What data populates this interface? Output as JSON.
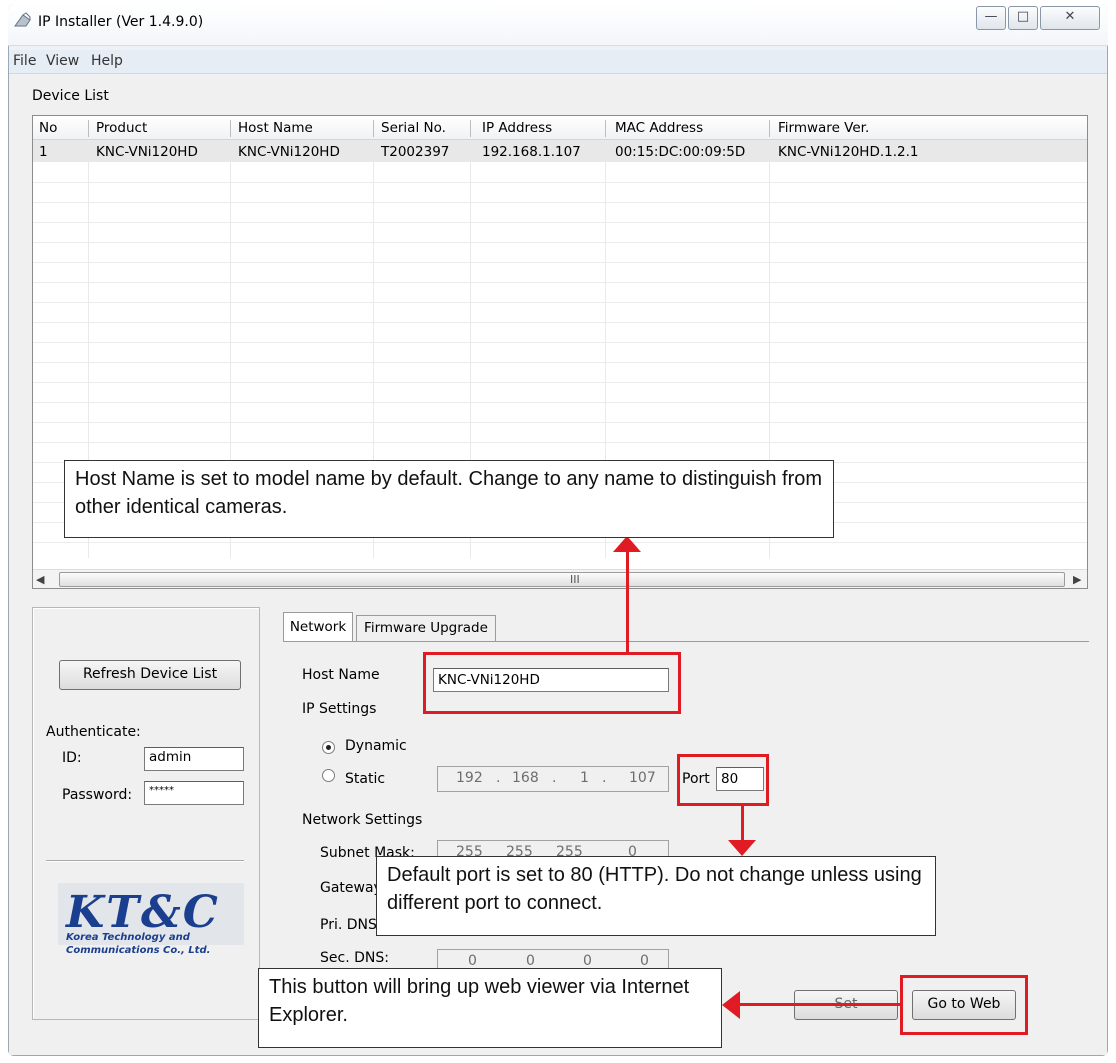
{
  "window": {
    "title": "IP Installer (Ver 1.4.9.0)",
    "controls": [
      "—",
      "□",
      "✕"
    ]
  },
  "menu": [
    "File",
    "View",
    "Help"
  ],
  "device_list": {
    "label": "Device List",
    "columns": [
      "No",
      "Product",
      "Host Name",
      "Serial No.",
      "IP Address",
      "MAC Address",
      "Firmware Ver."
    ],
    "rows": [
      [
        "1",
        "KNC-VNi120HD",
        "KNC-VNi120HD",
        "T2002397",
        "192.168.1.107",
        "00:15:DC:00:09:5D",
        "KNC-VNi120HD.1.2.1"
      ]
    ],
    "scroll_grip": "III"
  },
  "left_panel": {
    "refresh_label": "Refresh Device List",
    "authenticate_label": "Authenticate:",
    "id_label": "ID:",
    "id_value": "admin",
    "password_label": "Password:",
    "password_value": "*****",
    "logo_main": "KT&C",
    "logo_line1": "Korea Technology and",
    "logo_line2": "Communications Co., Ltd."
  },
  "tabs": [
    "Network",
    "Firmware Upgrade"
  ],
  "network": {
    "host_name_label": "Host Name",
    "host_name_value": "KNC-VNi120HD",
    "ip_settings_label": "IP Settings",
    "dynamic_label": "Dynamic",
    "static_label": "Static",
    "ip_octets": [
      "192",
      "168",
      "1",
      "107"
    ],
    "port_label": "Port",
    "port_value": "80",
    "network_settings_label": "Network Settings",
    "subnet_label": "Subnet Mask:",
    "subnet_octets": [
      "255",
      "255",
      "255",
      "0"
    ],
    "gateway_label": "Gateway:",
    "pri_dns_label": "Pri. DNS:",
    "sec_dns_label": "Sec. DNS:",
    "sec_dns_octets": [
      "0",
      "0",
      "0",
      "0"
    ],
    "set_label": "Set",
    "go_to_web_label": "Go to Web"
  },
  "annotations": {
    "host_name_note": "Host Name is set to model name by default. Change to any name to distinguish from other identical cameras.",
    "port_note": "Default port is set to 80 (HTTP). Do not change unless using different port to connect.",
    "web_note": "This button will bring up web viewer via Internet Explorer."
  },
  "colors": {
    "annotation_red": "#e01b24",
    "selected_row": "#e8e8e8"
  }
}
